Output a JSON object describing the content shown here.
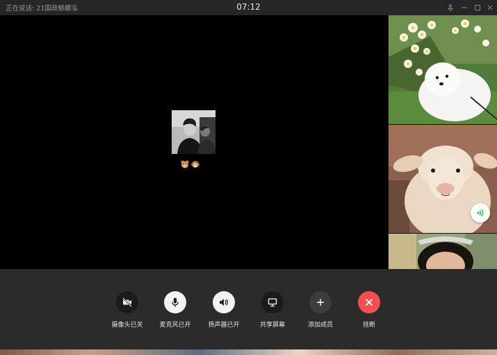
{
  "titlebar": {
    "speaking": "正在说话: 21国政郁娜泓",
    "timer": "07:12",
    "controls": [
      "pin-icon",
      "minimize-icon",
      "maximize-icon",
      "close-icon"
    ]
  },
  "main": {
    "avatar": "black-and-white-portrait",
    "nickname_icons": [
      "bear-emoji",
      "monkey-emoji"
    ]
  },
  "participants": [
    {
      "image": "samoyed-puppy-with-daffodils"
    },
    {
      "image": "sheep-face",
      "speaking": true
    },
    {
      "image": "girl-with-sunglasses"
    }
  ],
  "toolbar": {
    "camera": {
      "label": "摄像头已关",
      "icon": "camera-off-icon"
    },
    "mic": {
      "label": "麦克风已开",
      "icon": "microphone-icon"
    },
    "speaker": {
      "label": "扬声器已开",
      "icon": "speaker-icon"
    },
    "share": {
      "label": "共享屏幕",
      "icon": "screen-share-icon"
    },
    "add": {
      "label": "添加成员",
      "icon": "plus-icon"
    },
    "hangup": {
      "label": "挂断",
      "icon": "close-icon"
    }
  },
  "colors": {
    "toolbar_bg": "#2b2b2b",
    "titlebar_bg": "#262626",
    "hangup_red": "#f05050",
    "voice_green": "#22c55e"
  }
}
